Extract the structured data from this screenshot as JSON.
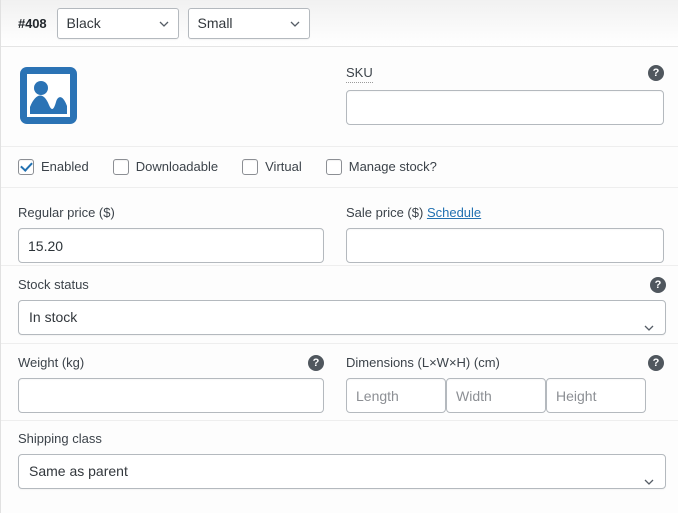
{
  "variation": {
    "id_label": "#408",
    "attributes": [
      {
        "name": "color",
        "value": "Black"
      },
      {
        "name": "size",
        "value": "Small"
      }
    ],
    "image": {
      "alt": "placeholder-image"
    },
    "sku": {
      "label": "SKU",
      "value": "",
      "placeholder": "",
      "help": "?"
    },
    "checkboxes": [
      {
        "label": "Enabled",
        "checked": true
      },
      {
        "label": "Downloadable",
        "checked": false
      },
      {
        "label": "Virtual",
        "checked": false
      },
      {
        "label": "Manage stock?",
        "checked": false
      }
    ],
    "regular_price": {
      "label": "Regular price ($)",
      "value": "15.20",
      "placeholder": ""
    },
    "sale_price": {
      "label": "Sale price ($)",
      "schedule_label": "Schedule",
      "value": "",
      "placeholder": ""
    },
    "stock_status": {
      "label": "Stock status",
      "value": "In stock",
      "help": "?"
    },
    "weight": {
      "label": "Weight (kg)",
      "value": "",
      "placeholder": "",
      "help": "?"
    },
    "dimensions": {
      "label": "Dimensions (L×W×H) (cm)",
      "help": "?",
      "length_placeholder": "Length",
      "width_placeholder": "Width",
      "height_placeholder": "Height",
      "length_value": "",
      "width_value": "",
      "height_value": ""
    },
    "shipping_class": {
      "label": "Shipping class",
      "value": "Same as parent"
    }
  },
  "colors": {
    "accent": "#2271b1",
    "placeholder_image": "#2b73b5",
    "label_text": "#3c434a",
    "border": "#b4b9be",
    "help_bg": "#50575e"
  }
}
